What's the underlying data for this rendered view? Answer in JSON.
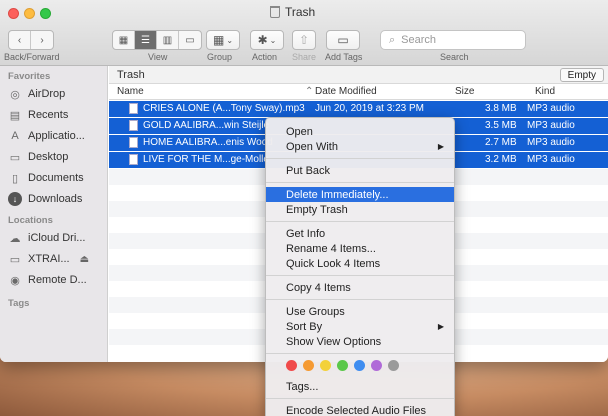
{
  "window": {
    "title": "Trash"
  },
  "toolbar": {
    "back_forward_label": "Back/Forward",
    "view_label": "View",
    "group_label": "Group",
    "action_label": "Action",
    "share_label": "Share",
    "add_tags_label": "Add Tags",
    "search_label": "Search",
    "search_placeholder": "Search"
  },
  "sidebar": {
    "favorites_header": "Favorites",
    "favorites": [
      {
        "label": "AirDrop",
        "icon": "airdrop-icon"
      },
      {
        "label": "Recents",
        "icon": "recents-icon"
      },
      {
        "label": "Applicatio...",
        "icon": "applications-icon"
      },
      {
        "label": "Desktop",
        "icon": "desktop-icon"
      },
      {
        "label": "Documents",
        "icon": "documents-icon"
      },
      {
        "label": "Downloads",
        "icon": "downloads-icon"
      }
    ],
    "locations_header": "Locations",
    "locations": [
      {
        "label": "iCloud Dri...",
        "icon": "icloud-icon"
      },
      {
        "label": "XTRAI...",
        "icon": "drive-icon",
        "eject": "⏏"
      },
      {
        "label": "Remote D...",
        "icon": "remote-disc-icon"
      }
    ],
    "tags_header": "Tags"
  },
  "main": {
    "path_title": "Trash",
    "empty_button": "Empty",
    "columns": {
      "name": "Name",
      "date": "Date Modified",
      "size": "Size",
      "kind": "Kind"
    },
    "files": [
      {
        "name": "CRIES ALONE (A...Tony Sway).mp3",
        "date": "Jun 20, 2019 at 3:23 PM",
        "size": "3.8 MB",
        "kind": "MP3 audio"
      },
      {
        "name": "GOLD AALIBRA...win Steijle",
        "date": "",
        "size": "3.5 MB",
        "kind": "MP3 audio"
      },
      {
        "name": "HOME AALIBRA...enis Wood",
        "date": "",
        "size": "2.7 MB",
        "kind": "MP3 audio"
      },
      {
        "name": "LIVE FOR THE M...ge-Molle",
        "date": "",
        "size": "3.2 MB",
        "kind": "MP3 audio"
      }
    ]
  },
  "context_menu": {
    "open": "Open",
    "open_with": "Open With",
    "put_back": "Put Back",
    "delete_immediately": "Delete Immediately...",
    "empty_trash": "Empty Trash",
    "get_info": "Get Info",
    "rename": "Rename 4 Items...",
    "quick_look": "Quick Look 4 Items",
    "copy": "Copy 4 Items",
    "use_groups": "Use Groups",
    "sort_by": "Sort By",
    "show_view_options": "Show View Options",
    "tag_colors": [
      "#f04a4a",
      "#f59a32",
      "#f3d13a",
      "#5bc84a",
      "#3f8df0",
      "#b06ad8",
      "#9a9a9a"
    ],
    "tags": "Tags...",
    "encode": "Encode Selected Audio Files"
  }
}
